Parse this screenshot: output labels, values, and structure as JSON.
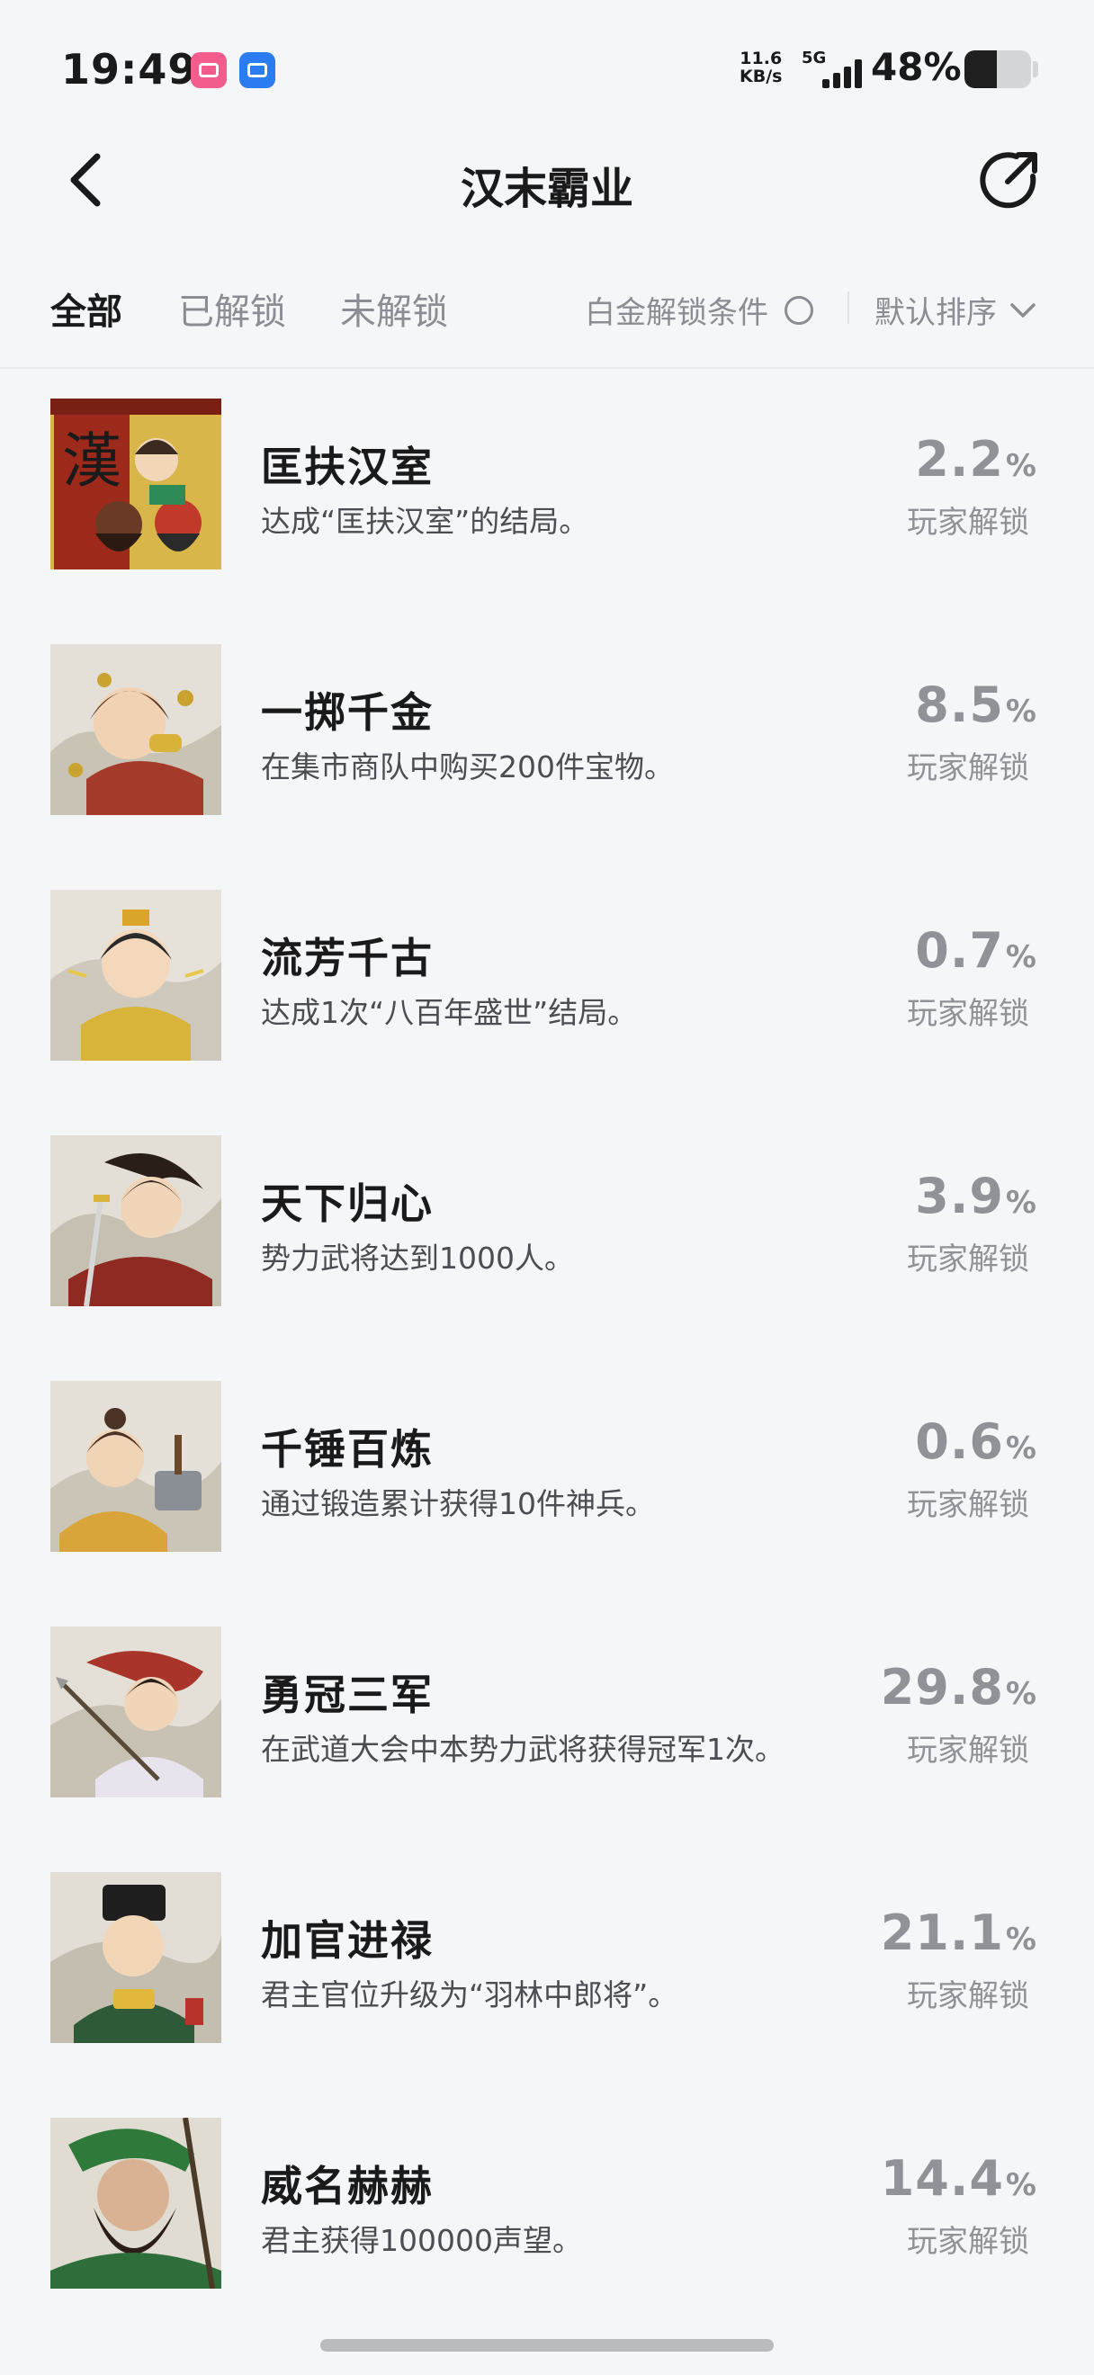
{
  "status_bar": {
    "time": "19:49",
    "app_icons": [
      "bilibili-icon",
      "screen-mirror-icon"
    ],
    "net_speed_value": "11.6",
    "net_speed_unit": "KB/s",
    "network_type": "5G",
    "battery_percent": "48%",
    "battery_level": 0.48
  },
  "nav": {
    "title": "汉末霸业",
    "back_icon": "chevron-left-icon",
    "share_icon": "share-icon"
  },
  "filters": {
    "tabs": [
      {
        "label": "全部",
        "active": true
      },
      {
        "label": "已解锁",
        "active": false
      },
      {
        "label": "未解锁",
        "active": false
      }
    ],
    "platinum_label": "白金解锁条件",
    "sort_label": "默认排序"
  },
  "achievements": [
    {
      "title": "匡扶汉室",
      "desc": "达成“匡扶汉室”的结局。",
      "percent": "2.2",
      "unlock_label": "玩家解锁"
    },
    {
      "title": "一掷千金",
      "desc": "在集市商队中购买200件宝物。",
      "percent": "8.5",
      "unlock_label": "玩家解锁"
    },
    {
      "title": "流芳千古",
      "desc": "达成1次“八百年盛世”结局。",
      "percent": "0.7",
      "unlock_label": "玩家解锁"
    },
    {
      "title": "天下归心",
      "desc": "势力武将达到1000人。",
      "percent": "3.9",
      "unlock_label": "玩家解锁"
    },
    {
      "title": "千锤百炼",
      "desc": "通过锻造累计获得10件神兵。",
      "percent": "0.6",
      "unlock_label": "玩家解锁"
    },
    {
      "title": "勇冠三军",
      "desc": "在武道大会中本势力武将获得冠军1次。",
      "percent": "29.8",
      "unlock_label": "玩家解锁"
    },
    {
      "title": "加官进禄",
      "desc": "君主官位升级为“羽林中郎将”。",
      "percent": "21.1",
      "unlock_label": "玩家解锁"
    },
    {
      "title": "威名赫赫",
      "desc": "君主获得100000声望。",
      "percent": "14.4",
      "unlock_label": "玩家解锁"
    }
  ],
  "percent_sign": "%",
  "thumb_badge_char": "漢"
}
